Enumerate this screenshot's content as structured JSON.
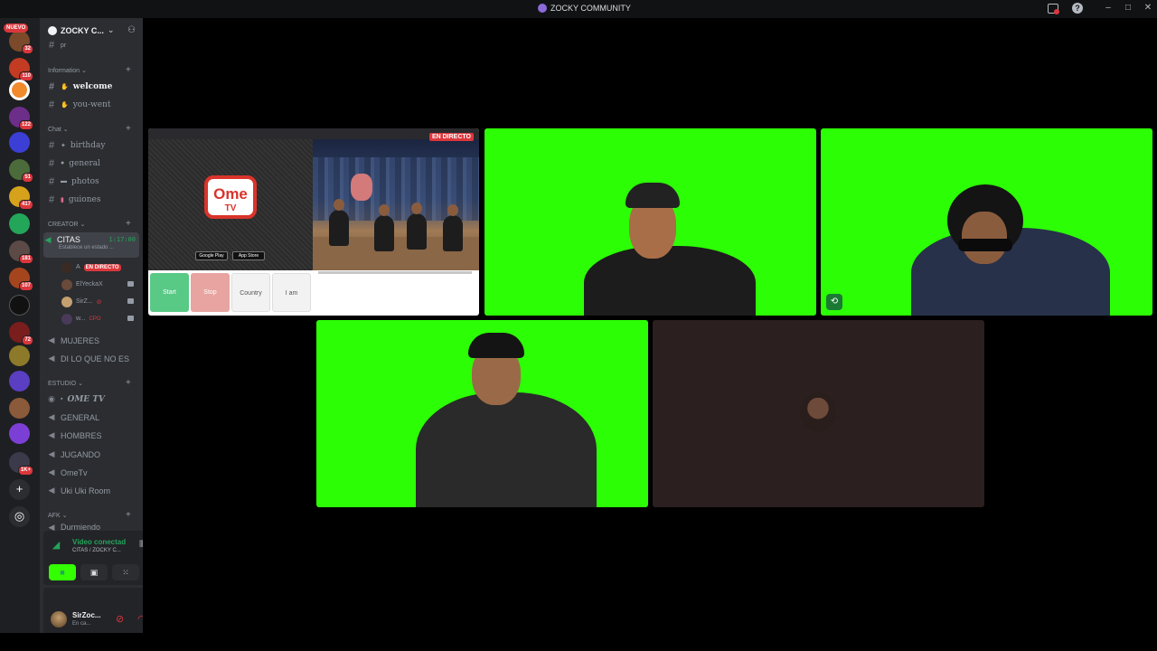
{
  "window": {
    "title": "ZOCKY COMMUNITY",
    "controls": {
      "minimize": "–",
      "maximize": "□",
      "close": "✕"
    }
  },
  "rail": {
    "nuevo": "NUEVO",
    "badges": [
      "32",
      "110",
      "122",
      "51",
      "417",
      "181",
      "107",
      "72",
      "1K+"
    ],
    "add_server": "+",
    "discover": "◎"
  },
  "server": {
    "name": "ZOCKY C...",
    "partial_channel": "pr"
  },
  "categories": {
    "information": "Information",
    "chat": "Chat",
    "creator": "CREATOR",
    "estudio": "ESTUDIO",
    "afk": "AFK"
  },
  "channels": {
    "welcome": "welcome",
    "you_went": "you-went",
    "birthday": "birthday",
    "general": "general",
    "photos": "photos",
    "guiones": "guiones",
    "citas": "CITAS",
    "citas_timer": "1:17:00",
    "citas_status": "Establece un estado ...",
    "mujeres": "MUJERES",
    "di_lo": "DI LO QUE NO ES",
    "ome_tv": "OME TV",
    "general_voice": "GENERAL",
    "hombres": "HOMBRES",
    "jugando": "JUGANDO",
    "ometv": "OmeTv",
    "uki": "Uki Uki Room",
    "durmiendo": "Durmiendo"
  },
  "members": [
    {
      "name": "A",
      "live": "EN DIRECTO"
    },
    {
      "name": "ElYeckaX"
    },
    {
      "name": "SirZ..."
    },
    {
      "name": "w...",
      "extra": "CPO"
    }
  ],
  "voice": {
    "status": "Vídeo conectad",
    "location": "CITAS / ZOCKY C..."
  },
  "user": {
    "name": "SirZoc...",
    "status": "En ca..."
  },
  "stream": {
    "live_label": "EN DIRECTO",
    "logo_top": "Ome",
    "logo_bottom": "TV",
    "google_play": "Google Play",
    "app_store": "App Store",
    "start": "Start",
    "stop": "Stop",
    "country": "Country",
    "iam": "I am"
  },
  "colors": {
    "accent_green": "#23a55a",
    "live_red": "#da373c",
    "chroma": "#2cff05"
  }
}
